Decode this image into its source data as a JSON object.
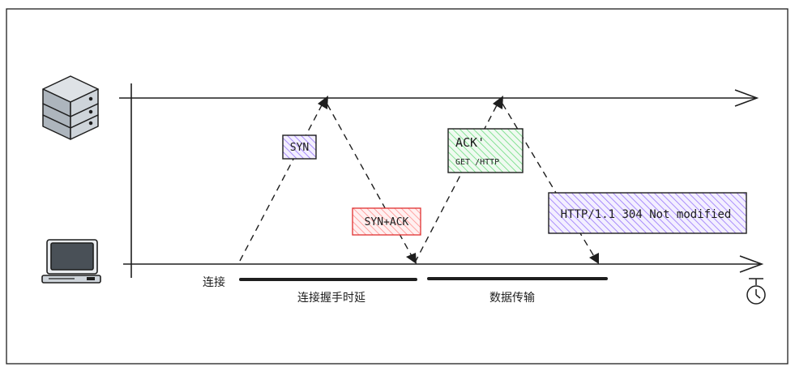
{
  "messages": {
    "syn": "SYN",
    "syn_ack": "SYN+ACK",
    "ack": "ACK'",
    "get": "GET /HTTP",
    "response": "HTTP/1.1 304 Not modified"
  },
  "labels": {
    "connect": "连接",
    "handshake_latency": "连接握手时延",
    "data_transfer": "数据传输"
  },
  "icons": {
    "server": "server-stack-icon",
    "client": "desktop-computer-icon",
    "time": "stopwatch-icon"
  },
  "colors": {
    "stroke": "#1e1e1e",
    "syn_fill": "#d0bfff",
    "syn_ack_fill": "#ffc9c9",
    "ack_fill": "#b2f2bb",
    "response_fill": "#d0bfff",
    "server_fill": "#ced4da",
    "monitor_fill": "#495057"
  }
}
